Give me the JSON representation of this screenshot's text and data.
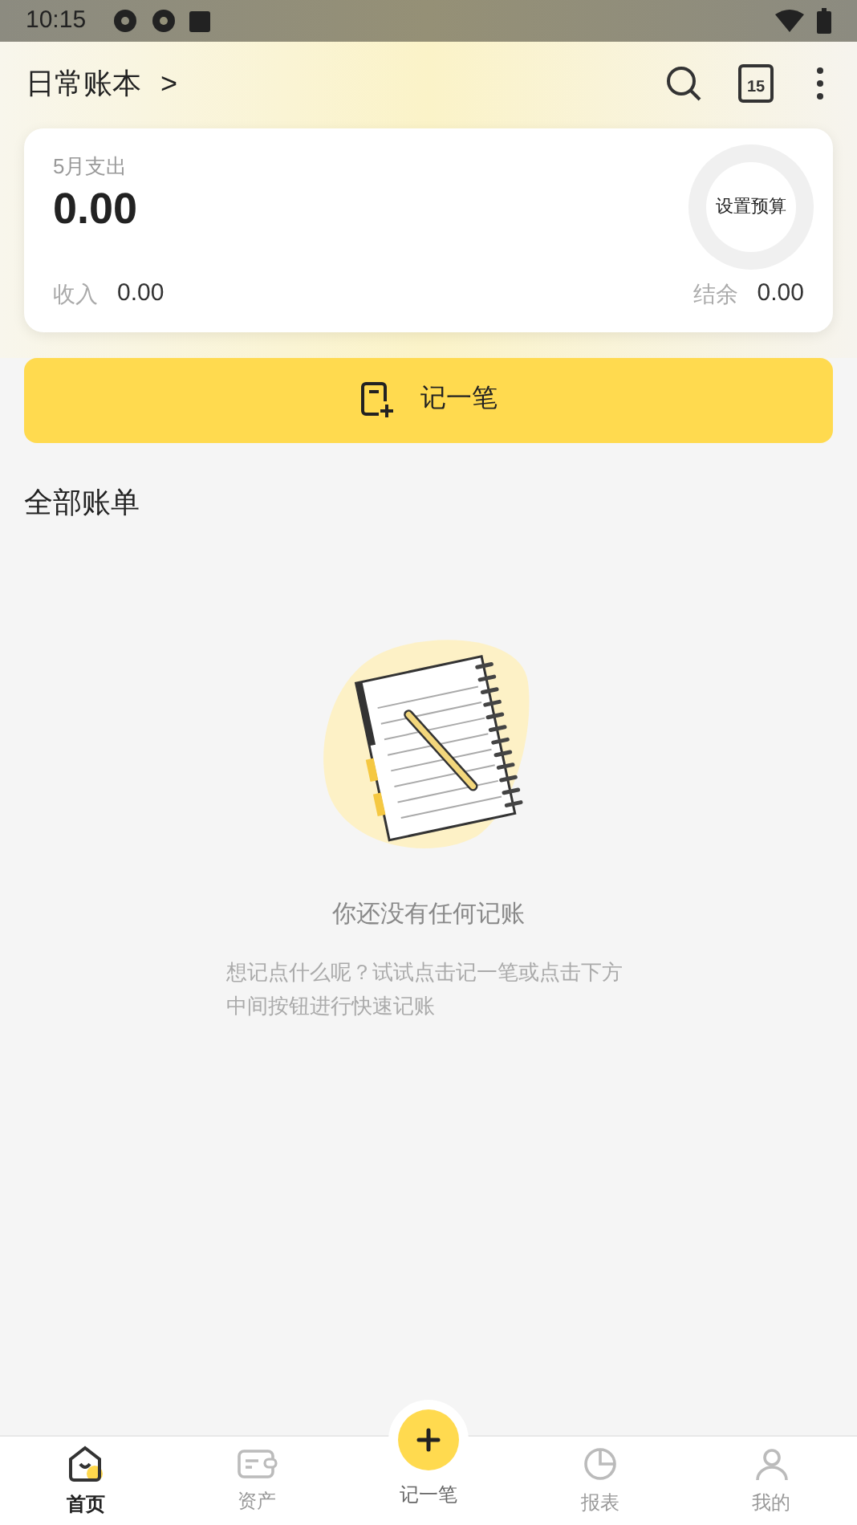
{
  "status_bar": {
    "time": "10:15"
  },
  "header": {
    "title": "日常账本",
    "chevron": ">",
    "calendar_day": "15"
  },
  "summary": {
    "label": "5月支出",
    "amount": "0.00",
    "budget": "设置预算",
    "income_label": "收入",
    "income": "0.00",
    "balance_label": "结余",
    "balance": "0.00"
  },
  "record_button": {
    "label": "记一笔"
  },
  "section_title": "全部账单",
  "empty_state": {
    "title": "你还没有任何记账",
    "hint": "想记点什么呢？试试点击记一笔或点击下方中间按钮进行快速记账"
  },
  "tabs": [
    {
      "kind": "home",
      "label": "首页",
      "selected": true
    },
    {
      "kind": "wallet",
      "label": "资产",
      "selected": false
    },
    {
      "kind": "add",
      "label": "记一笔",
      "selected": false
    },
    {
      "kind": "report",
      "label": "报表",
      "selected": false
    },
    {
      "kind": "me",
      "label": "我的",
      "selected": false
    }
  ]
}
